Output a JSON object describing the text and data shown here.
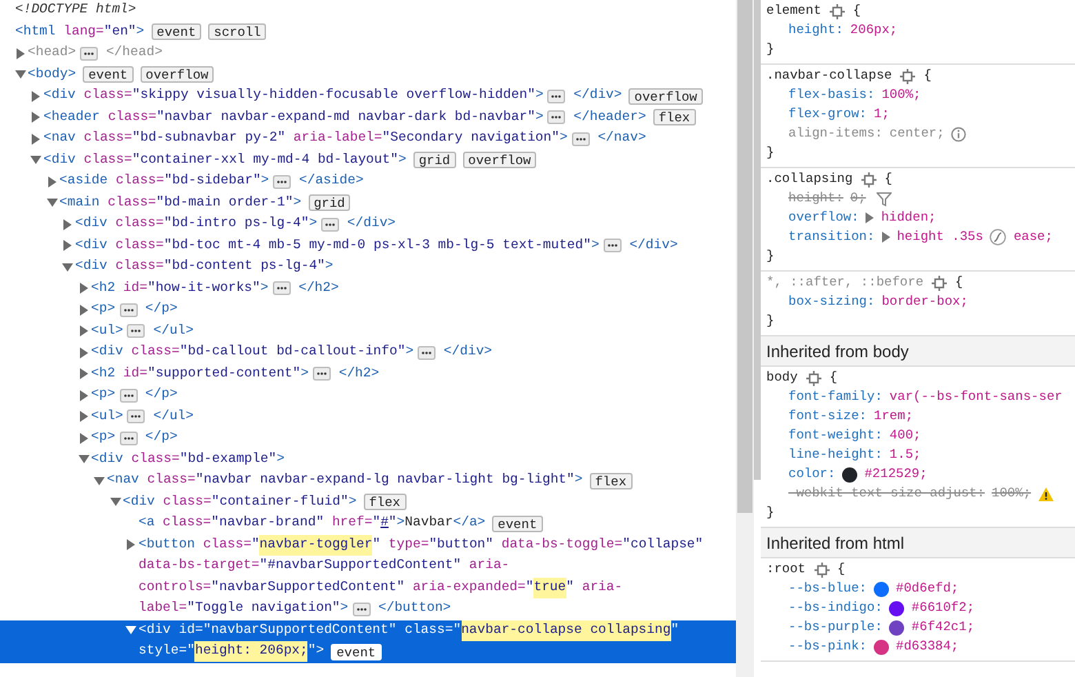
{
  "tree": [
    {
      "selected": false,
      "lines": [
        [
          {
            "kind": "doctype",
            "text": "<!DOCTYPE html>"
          }
        ]
      ]
    },
    {
      "selected": false,
      "lines": [
        [
          {
            "kind": "tag",
            "text": "<html"
          },
          {
            "kind": "attr",
            "text": " lang="
          },
          {
            "kind": "value",
            "text": "\"en\""
          },
          {
            "kind": "tag",
            "text": ">"
          },
          {
            "kind": "badge",
            "text": "event"
          },
          {
            "kind": "badge",
            "text": "scroll"
          }
        ]
      ],
      "children": [
        {
          "expanded": false,
          "selected": false,
          "lines": [
            [
              {
                "kind": "dim",
                "text": "<head>"
              },
              {
                "kind": "more"
              },
              {
                "kind": "dim",
                "text": " </head>"
              }
            ]
          ]
        },
        {
          "expanded": true,
          "selected": false,
          "lines": [
            [
              {
                "kind": "tag",
                "text": "<body>"
              },
              {
                "kind": "badge",
                "text": "event"
              },
              {
                "kind": "badge",
                "text": "overflow"
              }
            ]
          ],
          "children": [
            {
              "expanded": false,
              "selected": false,
              "lines": [
                [
                  {
                    "kind": "tag",
                    "text": "<div"
                  },
                  {
                    "kind": "attr",
                    "text": " class="
                  },
                  {
                    "kind": "value",
                    "text": "\"skippy visually-hidden-focusable overflow-hidden\""
                  },
                  {
                    "kind": "tag",
                    "text": ">"
                  },
                  {
                    "kind": "more"
                  },
                  {
                    "kind": "tag",
                    "text": " </div>"
                  },
                  {
                    "kind": "badge",
                    "text": "overflow"
                  }
                ]
              ]
            },
            {
              "expanded": false,
              "selected": false,
              "lines": [
                [
                  {
                    "kind": "tag",
                    "text": "<header"
                  },
                  {
                    "kind": "attr",
                    "text": " class="
                  },
                  {
                    "kind": "value",
                    "text": "\"navbar navbar-expand-md navbar-dark bd-navbar\""
                  },
                  {
                    "kind": "tag",
                    "text": ">"
                  },
                  {
                    "kind": "more"
                  },
                  {
                    "kind": "tag",
                    "text": " </header>"
                  },
                  {
                    "kind": "badge",
                    "text": "flex"
                  }
                ]
              ]
            },
            {
              "expanded": false,
              "selected": false,
              "lines": [
                [
                  {
                    "kind": "tag",
                    "text": "<nav"
                  },
                  {
                    "kind": "attr",
                    "text": " class="
                  },
                  {
                    "kind": "value",
                    "text": "\"bd-subnavbar py-2\""
                  },
                  {
                    "kind": "attr",
                    "text": " aria-label="
                  },
                  {
                    "kind": "value",
                    "text": "\"Secondary navigation\""
                  },
                  {
                    "kind": "tag",
                    "text": ">"
                  },
                  {
                    "kind": "more"
                  },
                  {
                    "kind": "tag",
                    "text": " </nav>"
                  }
                ]
              ]
            },
            {
              "expanded": true,
              "selected": false,
              "lines": [
                [
                  {
                    "kind": "tag",
                    "text": "<div"
                  },
                  {
                    "kind": "attr",
                    "text": " class="
                  },
                  {
                    "kind": "value",
                    "text": "\"container-xxl my-md-4 bd-layout\""
                  },
                  {
                    "kind": "tag",
                    "text": ">"
                  },
                  {
                    "kind": "badge",
                    "text": "grid"
                  },
                  {
                    "kind": "badge",
                    "text": "overflow"
                  }
                ]
              ],
              "children": [
                {
                  "expanded": false,
                  "selected": false,
                  "lines": [
                    [
                      {
                        "kind": "tag",
                        "text": "<aside"
                      },
                      {
                        "kind": "attr",
                        "text": " class="
                      },
                      {
                        "kind": "value",
                        "text": "\"bd-sidebar\""
                      },
                      {
                        "kind": "tag",
                        "text": ">"
                      },
                      {
                        "kind": "more"
                      },
                      {
                        "kind": "tag",
                        "text": " </aside>"
                      }
                    ]
                  ]
                },
                {
                  "expanded": true,
                  "selected": false,
                  "lines": [
                    [
                      {
                        "kind": "tag",
                        "text": "<main"
                      },
                      {
                        "kind": "attr",
                        "text": " class="
                      },
                      {
                        "kind": "value",
                        "text": "\"bd-main order-1\""
                      },
                      {
                        "kind": "tag",
                        "text": ">"
                      },
                      {
                        "kind": "badge",
                        "text": "grid"
                      }
                    ]
                  ],
                  "children": [
                    {
                      "expanded": false,
                      "selected": false,
                      "lines": [
                        [
                          {
                            "kind": "tag",
                            "text": "<div"
                          },
                          {
                            "kind": "attr",
                            "text": " class="
                          },
                          {
                            "kind": "value",
                            "text": "\"bd-intro ps-lg-4\""
                          },
                          {
                            "kind": "tag",
                            "text": ">"
                          },
                          {
                            "kind": "more"
                          },
                          {
                            "kind": "tag",
                            "text": " </div>"
                          }
                        ]
                      ]
                    },
                    {
                      "expanded": false,
                      "selected": false,
                      "lines": [
                        [
                          {
                            "kind": "tag",
                            "text": "<div"
                          },
                          {
                            "kind": "attr",
                            "text": " class="
                          },
                          {
                            "kind": "value",
                            "text": "\"bd-toc mt-4 mb-5 my-md-0 ps-xl-3 mb-lg-5 text-muted\""
                          },
                          {
                            "kind": "tag",
                            "text": ">"
                          },
                          {
                            "kind": "more"
                          },
                          {
                            "kind": "tag",
                            "text": " </div>"
                          }
                        ]
                      ]
                    },
                    {
                      "expanded": true,
                      "selected": false,
                      "lines": [
                        [
                          {
                            "kind": "tag",
                            "text": "<div"
                          },
                          {
                            "kind": "attr",
                            "text": " class="
                          },
                          {
                            "kind": "value",
                            "text": "\"bd-content ps-lg-4\""
                          },
                          {
                            "kind": "tag",
                            "text": ">"
                          }
                        ]
                      ],
                      "children": [
                        {
                          "expanded": false,
                          "selected": false,
                          "lines": [
                            [
                              {
                                "kind": "tag",
                                "text": "<h2"
                              },
                              {
                                "kind": "attr",
                                "text": " id="
                              },
                              {
                                "kind": "value",
                                "text": "\"how-it-works\""
                              },
                              {
                                "kind": "tag",
                                "text": ">"
                              },
                              {
                                "kind": "more"
                              },
                              {
                                "kind": "tag",
                                "text": " </h2>"
                              }
                            ]
                          ]
                        },
                        {
                          "expanded": false,
                          "selected": false,
                          "lines": [
                            [
                              {
                                "kind": "tag",
                                "text": "<p>"
                              },
                              {
                                "kind": "more"
                              },
                              {
                                "kind": "tag",
                                "text": " </p>"
                              }
                            ]
                          ]
                        },
                        {
                          "expanded": false,
                          "selected": false,
                          "lines": [
                            [
                              {
                                "kind": "tag",
                                "text": "<ul>"
                              },
                              {
                                "kind": "more"
                              },
                              {
                                "kind": "tag",
                                "text": " </ul>"
                              }
                            ]
                          ]
                        },
                        {
                          "expanded": false,
                          "selected": false,
                          "lines": [
                            [
                              {
                                "kind": "tag",
                                "text": "<div"
                              },
                              {
                                "kind": "attr",
                                "text": " class="
                              },
                              {
                                "kind": "value",
                                "text": "\"bd-callout bd-callout-info\""
                              },
                              {
                                "kind": "tag",
                                "text": ">"
                              },
                              {
                                "kind": "more"
                              },
                              {
                                "kind": "tag",
                                "text": " </div>"
                              }
                            ]
                          ]
                        },
                        {
                          "expanded": false,
                          "selected": false,
                          "lines": [
                            [
                              {
                                "kind": "tag",
                                "text": "<h2"
                              },
                              {
                                "kind": "attr",
                                "text": " id="
                              },
                              {
                                "kind": "value",
                                "text": "\"supported-content\""
                              },
                              {
                                "kind": "tag",
                                "text": ">"
                              },
                              {
                                "kind": "more"
                              },
                              {
                                "kind": "tag",
                                "text": " </h2>"
                              }
                            ]
                          ]
                        },
                        {
                          "expanded": false,
                          "selected": false,
                          "lines": [
                            [
                              {
                                "kind": "tag",
                                "text": "<p>"
                              },
                              {
                                "kind": "more"
                              },
                              {
                                "kind": "tag",
                                "text": " </p>"
                              }
                            ]
                          ]
                        },
                        {
                          "expanded": false,
                          "selected": false,
                          "lines": [
                            [
                              {
                                "kind": "tag",
                                "text": "<ul>"
                              },
                              {
                                "kind": "more"
                              },
                              {
                                "kind": "tag",
                                "text": " </ul>"
                              }
                            ]
                          ]
                        },
                        {
                          "expanded": false,
                          "selected": false,
                          "lines": [
                            [
                              {
                                "kind": "tag",
                                "text": "<p>"
                              },
                              {
                                "kind": "more"
                              },
                              {
                                "kind": "tag",
                                "text": " </p>"
                              }
                            ]
                          ]
                        },
                        {
                          "expanded": true,
                          "selected": false,
                          "lines": [
                            [
                              {
                                "kind": "tag",
                                "text": "<div"
                              },
                              {
                                "kind": "attr",
                                "text": " class="
                              },
                              {
                                "kind": "value",
                                "text": "\"bd-example\""
                              },
                              {
                                "kind": "tag",
                                "text": ">"
                              }
                            ]
                          ],
                          "children": [
                            {
                              "expanded": true,
                              "selected": false,
                              "lines": [
                                [
                                  {
                                    "kind": "tag",
                                    "text": "<nav"
                                  },
                                  {
                                    "kind": "attr",
                                    "text": " class="
                                  },
                                  {
                                    "kind": "value",
                                    "text": "\"navbar navbar-expand-lg navbar-light bg-light\""
                                  },
                                  {
                                    "kind": "tag",
                                    "text": ">"
                                  },
                                  {
                                    "kind": "badge",
                                    "text": "flex"
                                  }
                                ]
                              ],
                              "children": [
                                {
                                  "expanded": true,
                                  "selected": false,
                                  "lines": [
                                    [
                                      {
                                        "kind": "tag",
                                        "text": "<div"
                                      },
                                      {
                                        "kind": "attr",
                                        "text": " class="
                                      },
                                      {
                                        "kind": "value",
                                        "text": "\"container-fluid\""
                                      },
                                      {
                                        "kind": "tag",
                                        "text": ">"
                                      },
                                      {
                                        "kind": "badge",
                                        "text": "flex"
                                      }
                                    ]
                                  ],
                                  "children": [
                                    {
                                      "selected": false,
                                      "lines": [
                                        [
                                          {
                                            "kind": "tag",
                                            "text": "<a"
                                          },
                                          {
                                            "kind": "attr",
                                            "text": " class="
                                          },
                                          {
                                            "kind": "value",
                                            "text": "\"navbar-brand\""
                                          },
                                          {
                                            "kind": "attr",
                                            "text": " href="
                                          },
                                          {
                                            "kind": "value",
                                            "text": "\""
                                          },
                                          {
                                            "kind": "link",
                                            "text": "#"
                                          },
                                          {
                                            "kind": "value",
                                            "text": "\""
                                          },
                                          {
                                            "kind": "tag",
                                            "text": ">"
                                          },
                                          {
                                            "kind": "text",
                                            "text": "Navbar"
                                          },
                                          {
                                            "kind": "tag",
                                            "text": "</a>"
                                          },
                                          {
                                            "kind": "badge",
                                            "text": "event"
                                          }
                                        ]
                                      ]
                                    },
                                    {
                                      "expanded": false,
                                      "selected": false,
                                      "lines": [
                                        [
                                          {
                                            "kind": "tag",
                                            "text": "<button"
                                          },
                                          {
                                            "kind": "attr",
                                            "text": " class="
                                          },
                                          {
                                            "kind": "value",
                                            "text": "\""
                                          },
                                          {
                                            "kind": "mark",
                                            "text": "navbar-toggler"
                                          },
                                          {
                                            "kind": "value",
                                            "text": "\""
                                          },
                                          {
                                            "kind": "attr",
                                            "text": " type="
                                          },
                                          {
                                            "kind": "value",
                                            "text": "\"button\""
                                          },
                                          {
                                            "kind": "attr",
                                            "text": " data-bs-toggle="
                                          },
                                          {
                                            "kind": "value",
                                            "text": "\"collapse\""
                                          }
                                        ],
                                        [
                                          {
                                            "kind": "attr",
                                            "text": "data-bs-target="
                                          },
                                          {
                                            "kind": "value",
                                            "text": "\"#navbarSupportedContent\""
                                          },
                                          {
                                            "kind": "attr",
                                            "text": " aria-"
                                          }
                                        ],
                                        [
                                          {
                                            "kind": "attr",
                                            "text": "controls="
                                          },
                                          {
                                            "kind": "value",
                                            "text": "\"navbarSupportedContent\""
                                          },
                                          {
                                            "kind": "attr",
                                            "text": " aria-expanded="
                                          },
                                          {
                                            "kind": "value",
                                            "text": "\""
                                          },
                                          {
                                            "kind": "mark",
                                            "text": "true"
                                          },
                                          {
                                            "kind": "value",
                                            "text": "\""
                                          },
                                          {
                                            "kind": "attr",
                                            "text": " aria-"
                                          }
                                        ],
                                        [
                                          {
                                            "kind": "attr",
                                            "text": "label="
                                          },
                                          {
                                            "kind": "value",
                                            "text": "\"Toggle navigation\""
                                          },
                                          {
                                            "kind": "tag",
                                            "text": ">"
                                          },
                                          {
                                            "kind": "more"
                                          },
                                          {
                                            "kind": "tag",
                                            "text": " </button>"
                                          }
                                        ]
                                      ]
                                    },
                                    {
                                      "expanded": true,
                                      "selected": true,
                                      "lines": [
                                        [
                                          {
                                            "kind": "tag",
                                            "text": "<div"
                                          },
                                          {
                                            "kind": "attr",
                                            "text": " id="
                                          },
                                          {
                                            "kind": "value",
                                            "text": "\"navbarSupportedContent\""
                                          },
                                          {
                                            "kind": "attr",
                                            "text": " class="
                                          },
                                          {
                                            "kind": "value",
                                            "text": "\""
                                          },
                                          {
                                            "kind": "mark",
                                            "text": "navbar-collapse collapsing"
                                          },
                                          {
                                            "kind": "value",
                                            "text": "\""
                                          }
                                        ],
                                        [
                                          {
                                            "kind": "attr",
                                            "text": "style="
                                          },
                                          {
                                            "kind": "value",
                                            "text": "\""
                                          },
                                          {
                                            "kind": "mark",
                                            "text": "height: 206px;"
                                          },
                                          {
                                            "kind": "value",
                                            "text": "\""
                                          },
                                          {
                                            "kind": "tag",
                                            "text": ">"
                                          },
                                          {
                                            "kind": "badge",
                                            "text": "event"
                                          }
                                        ]
                                      ]
                                    }
                                  ]
                                }
                              ]
                            }
                          ]
                        }
                      ]
                    }
                  ]
                }
              ]
            }
          ]
        }
      ]
    }
  ],
  "styles": [
    {
      "kind": "rule",
      "selector": "element",
      "selector_dimmed": false,
      "open": "{",
      "close": "}",
      "properties": [
        {
          "name": "height:",
          "value": "206px;",
          "inactive": false,
          "overridden": false
        }
      ]
    },
    {
      "kind": "rule",
      "selector": ".navbar-collapse",
      "selector_dimmed": false,
      "open": "{",
      "close": "}",
      "properties": [
        {
          "name": "flex-basis:",
          "value": "100%;",
          "inactive": false,
          "overridden": false
        },
        {
          "name": "flex-grow:",
          "value": "1;",
          "inactive": false,
          "overridden": false
        },
        {
          "name": "align-items:",
          "value": "center;",
          "inactive": true,
          "overridden": false,
          "info_icon": true
        }
      ]
    },
    {
      "kind": "rule",
      "selector": ".collapsing",
      "selector_dimmed": false,
      "open": "{",
      "close": "}",
      "properties": [
        {
          "name": "height:",
          "value": "0;",
          "inactive": false,
          "overridden": true,
          "filter_icon": true
        },
        {
          "name": "overflow:",
          "value": "hidden;",
          "inactive": false,
          "overridden": false,
          "expander": true
        },
        {
          "name": "transition:",
          "value": "height .35s",
          "easing": "ease;",
          "inactive": false,
          "overridden": false,
          "expander": true
        }
      ]
    },
    {
      "kind": "rule",
      "selector": "*, ::after, ::before",
      "selector_dimmed": true,
      "open": "{",
      "close": "}",
      "properties": [
        {
          "name": "box-sizing:",
          "value": "border-box;",
          "inactive": false,
          "overridden": false
        }
      ]
    },
    {
      "kind": "header",
      "text": "Inherited from body"
    },
    {
      "kind": "rule",
      "selector": "body",
      "selector_dimmed": false,
      "open": "{",
      "close": "}",
      "properties": [
        {
          "name": "font-family:",
          "value": "var(--bs-font-sans-ser",
          "inactive": false,
          "overridden": false
        },
        {
          "name": "font-size:",
          "value": "1rem;",
          "inactive": false,
          "overridden": false
        },
        {
          "name": "font-weight:",
          "value": "400;",
          "inactive": false,
          "overridden": false
        },
        {
          "name": "line-height:",
          "value": "1.5;",
          "inactive": false,
          "overridden": false
        },
        {
          "name": "color:",
          "value": "#212529;",
          "color": "#212529",
          "inactive": false,
          "overridden": false
        },
        {
          "name": "-webkit-text-size-adjust:",
          "value": "100%;",
          "inactive": false,
          "overridden": true,
          "warning_icon": true
        }
      ]
    },
    {
      "kind": "header",
      "text": "Inherited from html"
    },
    {
      "kind": "rule",
      "selector": ":root",
      "selector_dimmed": false,
      "open": "{",
      "properties": [
        {
          "name": "--bs-blue:",
          "value": "#0d6efd;",
          "color": "#0d6efd",
          "inactive": false,
          "overridden": false
        },
        {
          "name": "--bs-indigo:",
          "value": "#6610f2;",
          "color": "#6610f2",
          "inactive": false,
          "overridden": false
        },
        {
          "name": "--bs-purple:",
          "value": "#6f42c1;",
          "color": "#6f42c1",
          "inactive": false,
          "overridden": false
        },
        {
          "name": "--bs-pink:",
          "value": "#d63384;",
          "color": "#d63384",
          "inactive": false,
          "overridden": false
        }
      ]
    }
  ]
}
